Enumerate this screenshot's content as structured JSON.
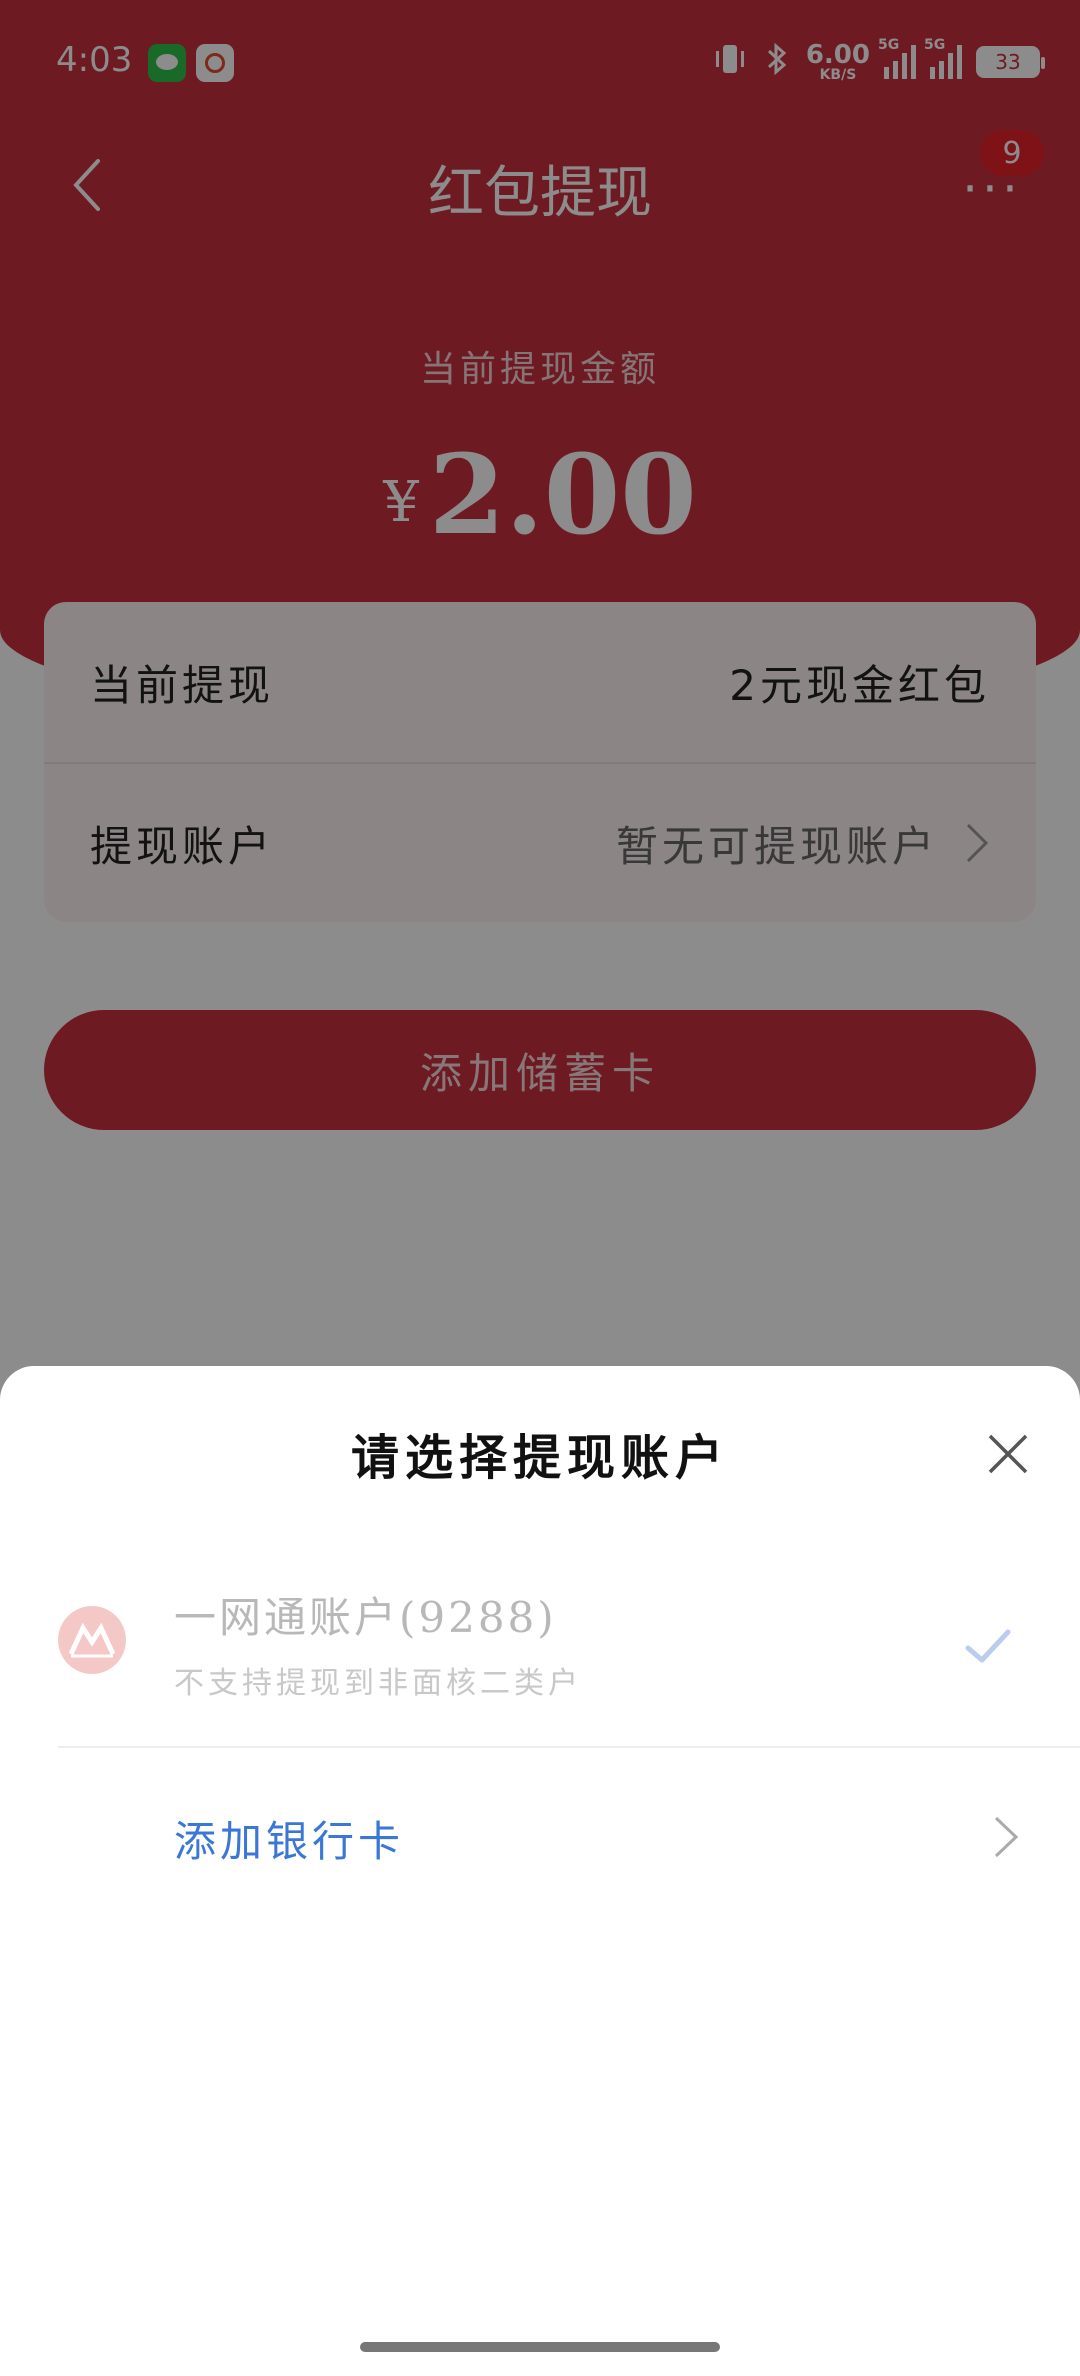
{
  "status_bar": {
    "time": "4:03",
    "net_speed_value": "6.00",
    "net_speed_unit": "KB/S",
    "signal1_tag": "5G",
    "signal2_tag": "5G",
    "battery": "33"
  },
  "nav": {
    "title": "红包提现",
    "more_glyph": "···",
    "badge_count": "9"
  },
  "withdraw": {
    "amount_label": "当前提现金额",
    "currency": "¥",
    "amount": "2.00",
    "rows": [
      {
        "label": "当前提现",
        "value": "2元现金红包"
      },
      {
        "label": "提现账户",
        "value": "暂无可提现账户"
      }
    ],
    "add_card_button": "添加储蓄卡"
  },
  "sheet": {
    "title": "请选择提现账户",
    "account": {
      "name": "一网通账户(9288)",
      "note": "不支持提现到非面核二类户"
    },
    "add_bank": "添加银行卡"
  },
  "colors": {
    "brand_red": "#c8303f",
    "link_blue": "#3b78d6",
    "badge_red": "#e6222a"
  },
  "icons": [
    "back-arrow-icon",
    "more-icon",
    "wechat-icon",
    "cmb-app-icon",
    "vibrate-icon",
    "bluetooth-icon",
    "signal-icon",
    "battery-icon",
    "chevron-right-icon",
    "close-icon",
    "cmb-logo-icon",
    "checkmark-icon"
  ]
}
